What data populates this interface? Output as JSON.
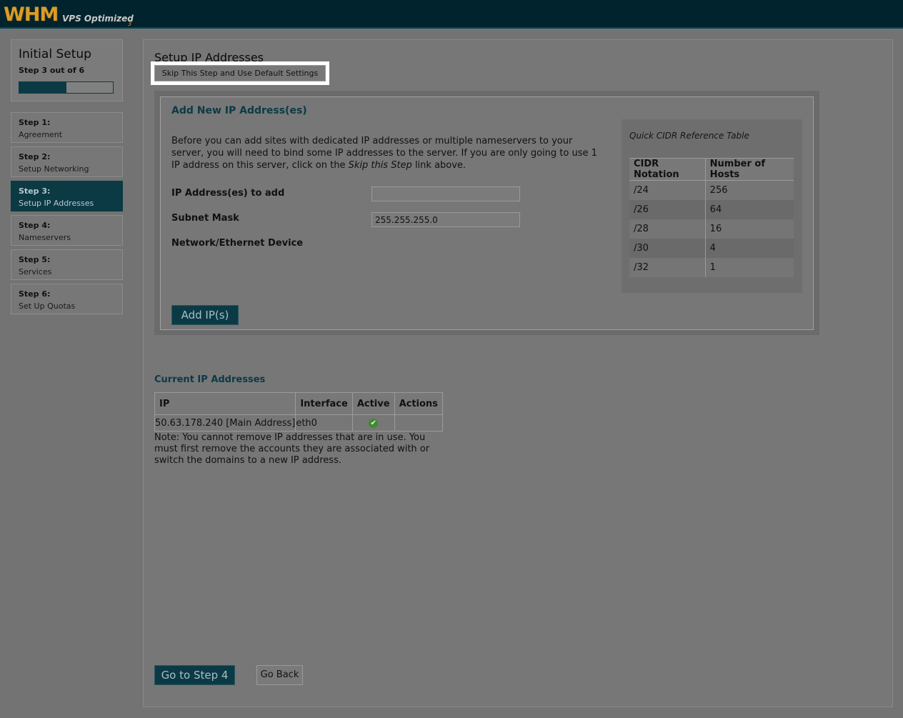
{
  "header": {
    "logo_main": "WHM",
    "logo_sub": "VPS Optimized",
    "logo_version": "3"
  },
  "sidebar": {
    "title": "Initial Setup",
    "step_indicator": "Step 3 out of 6",
    "progress_fraction": 0.5,
    "steps": [
      {
        "number": "Step 1:",
        "label": "Agreement",
        "active": false
      },
      {
        "number": "Step 2:",
        "label": "Setup Networking",
        "active": false
      },
      {
        "number": "Step 3:",
        "label": "Setup IP Addresses",
        "active": true
      },
      {
        "number": "Step 4:",
        "label": "Nameservers",
        "active": false
      },
      {
        "number": "Step 5:",
        "label": "Services",
        "active": false
      },
      {
        "number": "Step 6:",
        "label": "Set Up Quotas",
        "active": false
      }
    ]
  },
  "main": {
    "title": "Setup IP Addresses",
    "skip_button": "Skip This Step and Use Default Settings",
    "add_section": {
      "title": "Add New IP Address(es)",
      "intro_before": "Before you can add sites with dedicated IP addresses or multiple nameservers to your server, you will need to bind some IP addresses to the server. If you are only going to use 1 IP address on this server, click on the ",
      "intro_em": "Skip this Step",
      "intro_after": " link above.",
      "ip_label": "IP Address(es) to add",
      "ip_value": "",
      "subnet_label": "Subnet Mask",
      "subnet_value": "255.255.255.0",
      "device_label": "Network/Ethernet Device",
      "add_button": "Add IP(s)"
    },
    "cidr": {
      "caption": "Quick CIDR Reference Table",
      "headers": [
        "CIDR Notation",
        "Number of Hosts"
      ],
      "rows": [
        [
          "/24",
          "256"
        ],
        [
          "/26",
          "64"
        ],
        [
          "/28",
          "16"
        ],
        [
          "/30",
          "4"
        ],
        [
          "/32",
          "1"
        ]
      ]
    },
    "current": {
      "title": "Current IP Addresses",
      "headers": [
        "IP",
        "Interface",
        "Active",
        "Actions"
      ],
      "rows": [
        {
          "ip": "50.63.178.240 [Main Address]",
          "interface": "eth0",
          "active": "✔",
          "actions": ""
        }
      ],
      "note": "Note: You cannot remove IP addresses that are in use. You must first remove the accounts they are associated with or switch the domains to a new IP address."
    },
    "next_button": "Go to Step 4",
    "back_button": "Go Back"
  },
  "colors": {
    "brand_dark": "#0b3a45",
    "header_bg": "#00232d",
    "logo_orange": "#d89d2a",
    "active_check": "#3f8a2e"
  }
}
